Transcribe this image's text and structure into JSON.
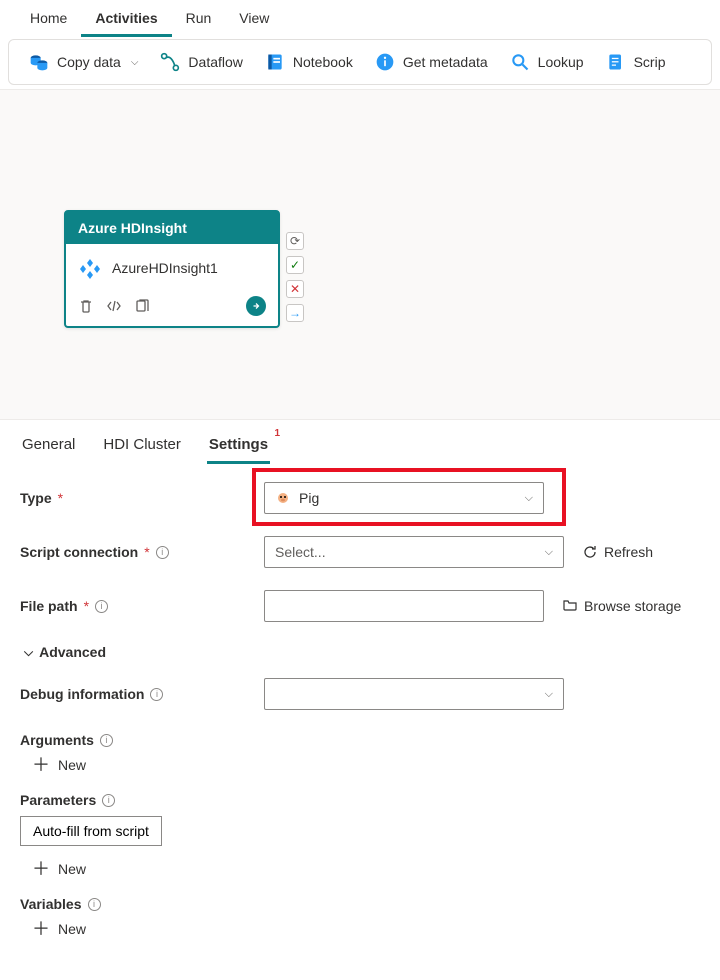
{
  "topTabs": [
    "Home",
    "Activities",
    "Run",
    "View"
  ],
  "topActiveIndex": 1,
  "toolbar": {
    "copyData": "Copy data",
    "dataflow": "Dataflow",
    "notebook": "Notebook",
    "getMetadata": "Get metadata",
    "lookup": "Lookup",
    "script": "Scrip"
  },
  "activity": {
    "header": "Azure HDInsight",
    "name": "AzureHDInsight1"
  },
  "propTabs": {
    "general": "General",
    "hdi": "HDI Cluster",
    "settings": "Settings",
    "badge": "1",
    "activeIndex": 2
  },
  "form": {
    "typeLabel": "Type",
    "typeValue": "Pig",
    "scriptConnLabel": "Script connection",
    "scriptConnPlaceholder": "Select...",
    "refresh": "Refresh",
    "filePathLabel": "File path",
    "browseStorage": "Browse storage",
    "advanced": "Advanced",
    "debugLabel": "Debug information",
    "argsLabel": "Arguments",
    "paramsLabel": "Parameters",
    "autoFill": "Auto-fill from script",
    "varsLabel": "Variables",
    "new": "New"
  }
}
